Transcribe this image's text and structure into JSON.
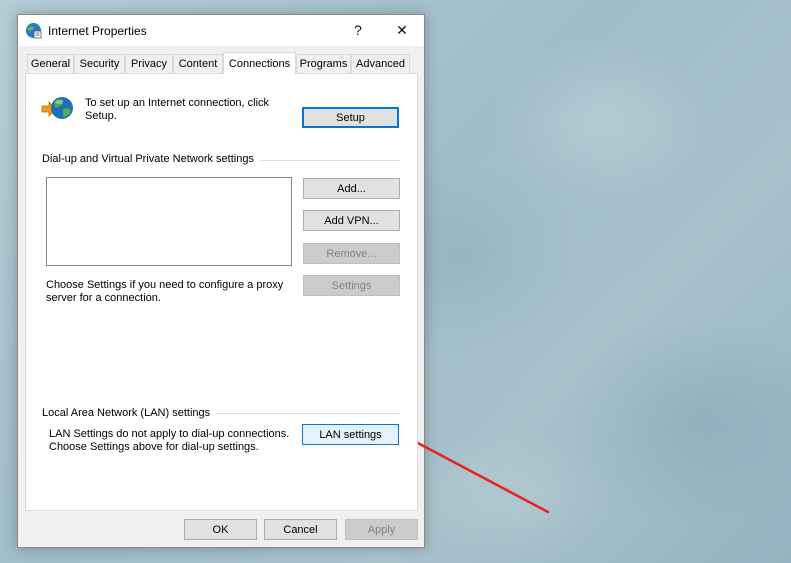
{
  "window": {
    "title": "Internet Properties",
    "help_glyph": "?",
    "close_glyph": "✕"
  },
  "tabs": [
    {
      "label": "General",
      "active": false
    },
    {
      "label": "Security",
      "active": false
    },
    {
      "label": "Privacy",
      "active": false
    },
    {
      "label": "Content",
      "active": false
    },
    {
      "label": "Connections",
      "active": true
    },
    {
      "label": "Programs",
      "active": false
    },
    {
      "label": "Advanced",
      "active": false
    }
  ],
  "connections": {
    "setup_text_line1": "To set up an Internet connection, click",
    "setup_text_line2": "Setup.",
    "setup_button": "Setup",
    "dialup_group_label": "Dial-up and Virtual Private Network settings",
    "add_button": "Add...",
    "add_vpn_button": "Add VPN...",
    "remove_button": "Remove...",
    "settings_button": "Settings",
    "proxy_text_line1": "Choose Settings if you need to configure a proxy",
    "proxy_text_line2": "server for a connection.",
    "lan_group_label": "Local Area Network (LAN) settings",
    "lan_text_line1": "LAN Settings do not apply to dial-up connections.",
    "lan_text_line2": "Choose Settings above for dial-up settings.",
    "lan_settings_button": "LAN settings"
  },
  "footer": {
    "ok_button": "OK",
    "cancel_button": "Cancel",
    "apply_button": "Apply"
  },
  "colors": {
    "annotation_arrow": "#e8231f",
    "focus_border": "#0078d7"
  }
}
